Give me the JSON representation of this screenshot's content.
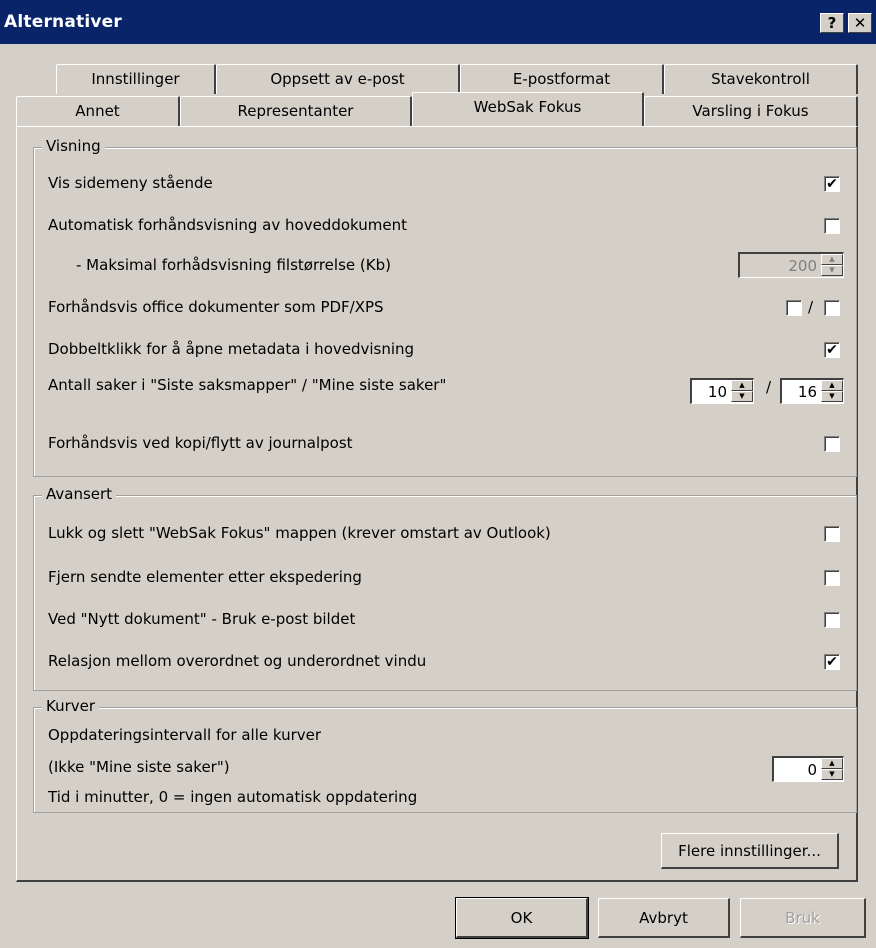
{
  "window": {
    "title": "Alternativer",
    "help_label": "?",
    "close_label": "✕"
  },
  "tabs": {
    "row1": [
      "Innstillinger",
      "Oppsett av e-post",
      "E-postformat",
      "Stavekontroll"
    ],
    "row2": [
      "Annet",
      "Representanter",
      "WebSak Fokus",
      "Varsling i Fokus"
    ],
    "active": "WebSak Fokus"
  },
  "visning": {
    "legend": "Visning",
    "vis_sidemeny": {
      "label": "Vis sidemeny stående",
      "checked": true,
      "mark": "✔"
    },
    "auto_forhand": {
      "label": "Automatisk forhåndsvisning av hoveddokument",
      "checked": false
    },
    "maks_filstorrelse": {
      "label": "- Maksimal forhådsvisning filstørrelse (Kb)",
      "value": "200",
      "disabled": true
    },
    "forhand_office": {
      "label": "Forhåndsvis office dokumenter som PDF/XPS",
      "separator": "/"
    },
    "dobbeltklikk": {
      "label": "Dobbeltklikk for å åpne metadata i hovedvisning",
      "checked": true,
      "mark": "✔"
    },
    "antall_saker": {
      "label": "Antall saker i \"Siste saksmapper\" / \"Mine siste saker\"",
      "value1": "10",
      "value2": "16",
      "separator": "/"
    },
    "forhand_kopi": {
      "label": "Forhåndsvis ved kopi/flytt av journalpost",
      "checked": false
    }
  },
  "avansert": {
    "legend": "Avansert",
    "lukk_slett": {
      "label": "Lukk og slett \"WebSak Fokus\" mappen (krever omstart av Outlook)",
      "checked": false
    },
    "fjern_sendte": {
      "label": "Fjern sendte elementer etter ekspedering",
      "checked": false
    },
    "nytt_dokument": {
      "label": "Ved \"Nytt dokument\" - Bruk e-post bildet",
      "checked": false
    },
    "relasjon": {
      "label": "Relasjon mellom overordnet og underordnet vindu",
      "checked": true,
      "mark": "✔"
    }
  },
  "kurver": {
    "legend": "Kurver",
    "line1": "Oppdateringsintervall for alle kurver",
    "line2": "(Ikke \"Mine siste saker\")",
    "line3": "Tid i minutter, 0 = ingen automatisk oppdatering",
    "value": "0"
  },
  "buttons": {
    "flere": "Flere innstillinger...",
    "ok": "OK",
    "avbryt": "Avbryt",
    "bruk": "Bruk"
  },
  "spin_arrows": {
    "up": "▲",
    "down": "▼"
  }
}
